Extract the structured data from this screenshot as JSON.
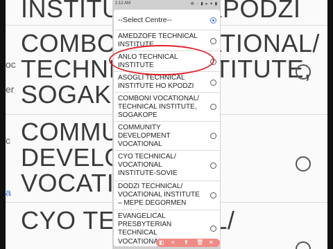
{
  "status_bar": {
    "time": "1:12 AM",
    "icons": "⚙ ◦ ▮ ▸ ▾ ▮"
  },
  "background_page": {
    "items": [
      "INSTITUTE HO KPODZI",
      "COMBONI VOCATIONAL/\nTECHNICAL INSTITUTE,\nSOGAKOPE",
      "COMMUNITY\nDEVELOPMENT\nVOCATIONAL",
      "CYO TECHNICAL/"
    ],
    "edge_fragments": [
      "oc",
      "er",
      "a",
      "c"
    ]
  },
  "dropdown": {
    "header": "--Select Centre--",
    "selected_index": -1,
    "options": [
      "AMEDZOFE TECHNICAL\nINSTITUTE",
      "ANLO TECHNICAL\nINSTITUTE",
      "ASOGLI TECHNICAL\nINSTITUTE HO KPODZI",
      "COMBONI VOCATIONAL/\nTECHNICAL INSTITUTE,\nSOGAKOPE",
      "COMMUNITY\nDEVELOPMENT\nVOCATIONAL",
      "CYO TECHNICAL/\nVOCATIONAL\nINSTITUTE-SOVIE",
      "DODZI TECHNICAL/\nVOCATIONAL INSTITUTE\n– MEPE DEGORMEN",
      "EVANGELICAL\nPRESBYTERIAN\nTECHNICAL\nVOCATIONAL INST"
    ]
  },
  "annotation": {
    "color": "#e0202a",
    "target_option": "ANLO TECHNICAL\nINSTITUTE"
  },
  "toolbar": {
    "icons": [
      "◧",
      "⌗",
      "⬆",
      "🗑",
      "✕"
    ]
  },
  "colors": {
    "accent": "#3c6fd9",
    "annotation": "#e0202a",
    "toolbar": "#ef8b86"
  }
}
